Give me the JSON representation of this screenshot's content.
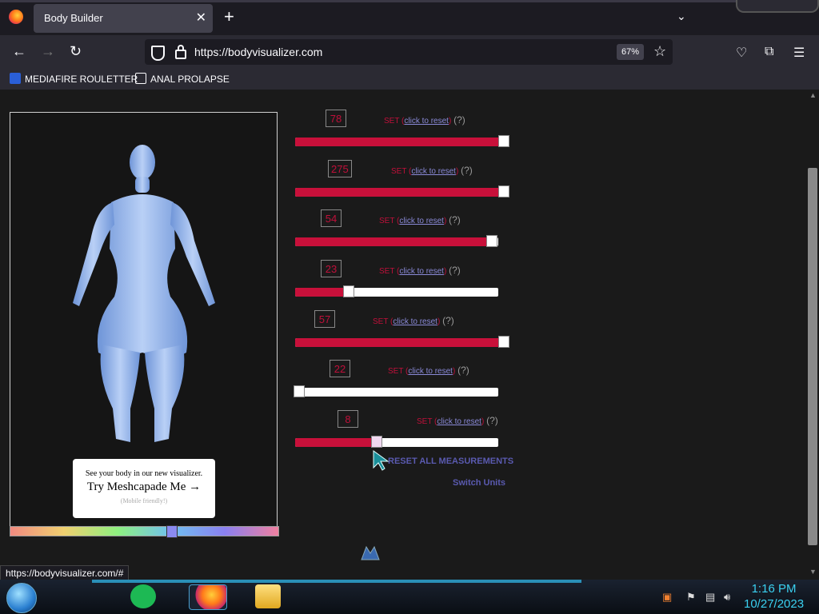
{
  "browser": {
    "tab_title": "Body Builder",
    "url": "https://bodyvisualizer.com",
    "zoom": "67%",
    "bookmarks": [
      {
        "label": "MEDIAFIRE ROULETTER"
      },
      {
        "label": "ANAL PROLAPSE"
      }
    ],
    "status_link": "https://bodyvisualizer.com/#"
  },
  "viewer": {
    "promo_line1": "See your body in our new visualizer.",
    "promo_line2": "Try Meshcapade Me",
    "promo_line3": "(Mobile friendly!)"
  },
  "measurements": [
    {
      "value": "78",
      "fraction": 1.0
    },
    {
      "value": "275",
      "fraction": 1.0
    },
    {
      "value": "54",
      "fraction": 0.97
    },
    {
      "value": "23",
      "fraction": 0.25
    },
    {
      "value": "57",
      "fraction": 1.0
    },
    {
      "value": "22",
      "fraction": 0.0
    },
    {
      "value": "8",
      "fraction": 0.39
    }
  ],
  "controls": {
    "set_label": "SET",
    "reset_label": "click to reset",
    "help_label": "?",
    "reset_all": "RESET ALL MEASUREMENTS",
    "switch_units": "Switch Units"
  },
  "taskbar": {
    "time": "1:16 PM",
    "date": "10/27/2023"
  }
}
